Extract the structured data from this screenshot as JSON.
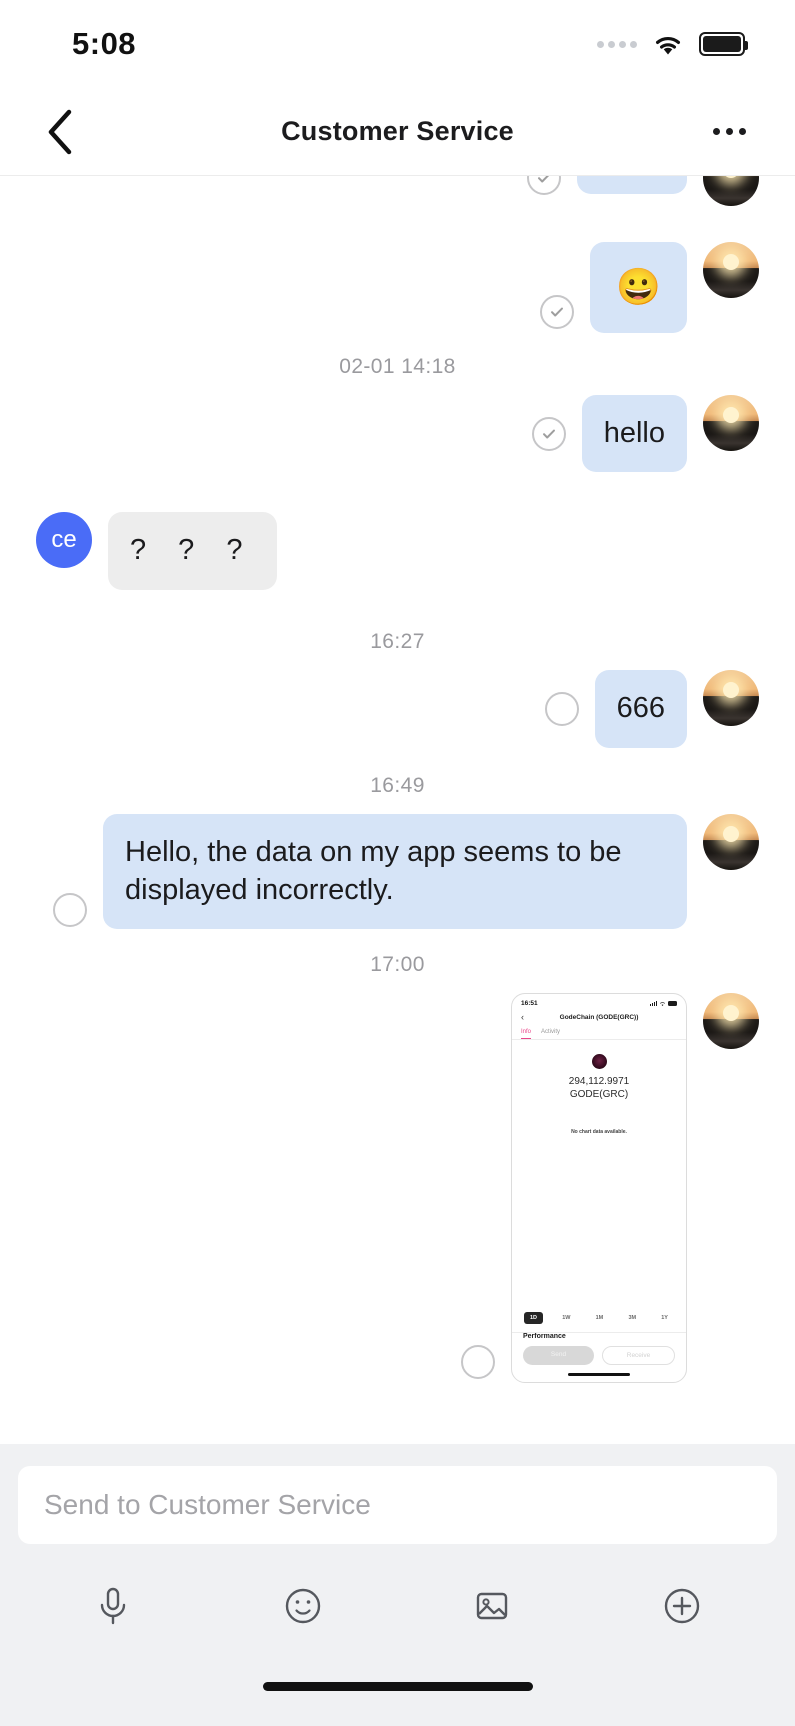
{
  "status_bar": {
    "time": "5:08",
    "signal_icon": "signal-dots-icon",
    "wifi_icon": "wifi-icon",
    "battery_icon": "battery-full-icon"
  },
  "nav": {
    "back_icon": "chevron-left-icon",
    "title": "Customer Service",
    "more_icon": "ellipsis-icon"
  },
  "messages": [
    {
      "id": "m0",
      "direction": "out",
      "type": "bubble-partial",
      "text": "",
      "status": "delivered",
      "avatar": "sunset-avatar"
    },
    {
      "id": "m1",
      "direction": "out",
      "type": "emoji",
      "text": "😀",
      "status": "delivered",
      "avatar": "sunset-avatar"
    },
    {
      "id": "t1",
      "type": "timestamp",
      "text": "02-01 14:18"
    },
    {
      "id": "m2",
      "direction": "out",
      "type": "text",
      "text": "hello",
      "status": "delivered",
      "avatar": "sunset-avatar"
    },
    {
      "id": "m3",
      "direction": "in",
      "type": "text",
      "text": "? ? ?",
      "avatar_initials": "ce"
    },
    {
      "id": "t2",
      "type": "timestamp",
      "text": "16:27"
    },
    {
      "id": "m4",
      "direction": "out",
      "type": "text",
      "text": "666",
      "status": "pending",
      "avatar": "sunset-avatar"
    },
    {
      "id": "t3",
      "type": "timestamp",
      "text": "16:49"
    },
    {
      "id": "m5",
      "direction": "out",
      "type": "text",
      "text": "Hello, the data on my app seems to be displayed incorrectly.",
      "status": "pending",
      "avatar": "sunset-avatar"
    },
    {
      "id": "t4",
      "type": "timestamp",
      "text": "17:00"
    },
    {
      "id": "m6",
      "direction": "out",
      "type": "image",
      "status": "pending",
      "avatar": "sunset-avatar"
    }
  ],
  "timestamps": {
    "ts1": "02-01 14:18",
    "ts2": "16:27",
    "ts3": "16:49",
    "ts4": "17:00"
  },
  "bubbles": {
    "emoji": "😀",
    "hello": "hello",
    "question": "? ? ?",
    "num": "666",
    "issue": "Hello, the data on my app seems to be displayed incorrectly."
  },
  "avatars": {
    "contact_initials": "ce",
    "contact_initials_color": "#4a6cf7",
    "user_avatar_name": "sunset-avatar"
  },
  "embedded_screenshot": {
    "status_time": "16:51",
    "back_icon": "chevron-left-icon",
    "title": "GodeChain (GODE(GRC))",
    "tabs": [
      {
        "label": "Info",
        "active": true
      },
      {
        "label": "Activity",
        "active": false
      }
    ],
    "token_logo": "gode-token-icon",
    "balance_amount": "294,112.9971",
    "balance_symbol": "GODE(GRC)",
    "chart_empty_text": "No chart data available.",
    "ranges": [
      {
        "label": "1D",
        "active": true
      },
      {
        "label": "1W",
        "active": false
      },
      {
        "label": "1M",
        "active": false
      },
      {
        "label": "3M",
        "active": false
      },
      {
        "label": "1Y",
        "active": false
      }
    ],
    "performance_label": "Performance",
    "send_button": "Send",
    "receive_button": "Receive"
  },
  "composer": {
    "placeholder": "Send to Customer Service",
    "value": "",
    "tools": [
      {
        "name": "microphone-icon",
        "label": "Voice"
      },
      {
        "name": "emoji-icon",
        "label": "Emoji"
      },
      {
        "name": "image-icon",
        "label": "Photo"
      },
      {
        "name": "plus-icon",
        "label": "More"
      }
    ]
  },
  "colors": {
    "outgoing_bubble": "#d6e4f7",
    "incoming_bubble": "#ededed",
    "accent_pink": "#e8468a",
    "avatar_blue": "#4a6cf7",
    "composer_bg": "#f0f1f3"
  }
}
